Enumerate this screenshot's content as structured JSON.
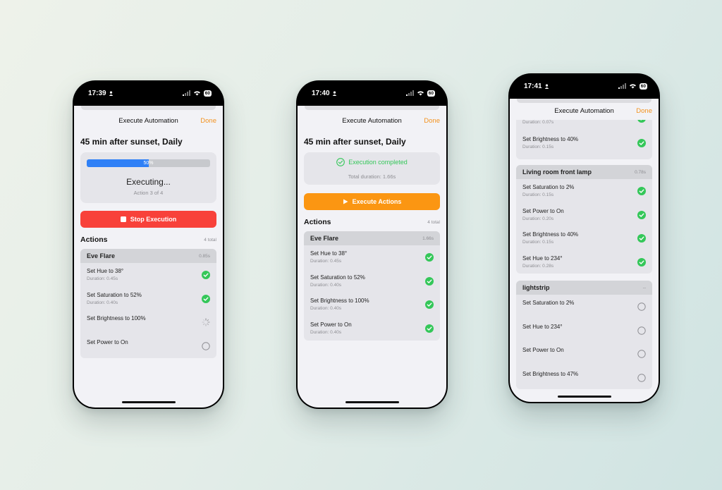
{
  "colors": {
    "accent_orange": "#f3921e",
    "stop_red": "#f8413a",
    "execute_orange": "#fb9612",
    "success_green": "#34c759",
    "progress_blue": "#2f80f6"
  },
  "phone1": {
    "time": "17:39",
    "battery": "60",
    "header_title": "Execute Automation",
    "done_label": "Done",
    "automation_title": "45 min after sunset, Daily",
    "progress": {
      "value_percent": 50,
      "label": "50%"
    },
    "executing_title": "Executing...",
    "executing_subtitle": "Action 3 of 4",
    "stop_label": "Stop Execution",
    "actions_title": "Actions",
    "actions_count": "4 total",
    "group": {
      "name": "Eve Flare",
      "duration": "0.85s",
      "actions": [
        {
          "label": "Set Hue to 38°",
          "duration": "Duration: 0.45s",
          "status": "done"
        },
        {
          "label": "Set Saturation to 52%",
          "duration": "Duration: 0.40s",
          "status": "done"
        },
        {
          "label": "Set Brightness to 100%",
          "duration": "",
          "status": "running"
        },
        {
          "label": "Set Power to On",
          "duration": "",
          "status": "pending"
        }
      ]
    }
  },
  "phone2": {
    "time": "17:40",
    "battery": "60",
    "header_title": "Execute Automation",
    "done_label": "Done",
    "automation_title": "45 min after sunset, Daily",
    "completed_title": "Execution completed",
    "completed_subtitle": "Total duration: 1.66s",
    "execute_label": "Execute Actions",
    "actions_title": "Actions",
    "actions_count": "4 total",
    "group": {
      "name": "Eve Flare",
      "duration": "1.66s",
      "actions": [
        {
          "label": "Set Hue to 38°",
          "duration": "Duration: 0.45s",
          "status": "done"
        },
        {
          "label": "Set Saturation to 52%",
          "duration": "Duration: 0.40s",
          "status": "done"
        },
        {
          "label": "Set Brightness to 100%",
          "duration": "Duration: 0.40s",
          "status": "done"
        },
        {
          "label": "Set Power to On",
          "duration": "Duration: 0.40s",
          "status": "done"
        }
      ]
    }
  },
  "phone3": {
    "time": "17:41",
    "battery": "60",
    "header_title": "Execute Automation",
    "done_label": "Done",
    "partial_duration": "Duration: 0.07s",
    "partial_row": {
      "label": "Set Brightness to 40%",
      "duration": "Duration: 0.15s",
      "status": "done"
    },
    "group_lamp": {
      "name": "Living room front lamp",
      "duration": "0.78s",
      "actions": [
        {
          "label": "Set Saturation to 2%",
          "duration": "Duration: 0.15s",
          "status": "done"
        },
        {
          "label": "Set Power to On",
          "duration": "Duration: 0.20s",
          "status": "done"
        },
        {
          "label": "Set Brightness to 40%",
          "duration": "Duration: 0.15s",
          "status": "done"
        },
        {
          "label": "Set Hue to 234°",
          "duration": "Duration: 0.28s",
          "status": "done"
        }
      ]
    },
    "group_strip": {
      "name": "lightstrip",
      "duration": "--",
      "actions": [
        {
          "label": "Set Saturation to 2%",
          "duration": "",
          "status": "pending"
        },
        {
          "label": "Set Hue to 234°",
          "duration": "",
          "status": "pending"
        },
        {
          "label": "Set Power to On",
          "duration": "",
          "status": "pending"
        },
        {
          "label": "Set Brightness to 47%",
          "duration": "",
          "status": "pending"
        }
      ]
    }
  }
}
